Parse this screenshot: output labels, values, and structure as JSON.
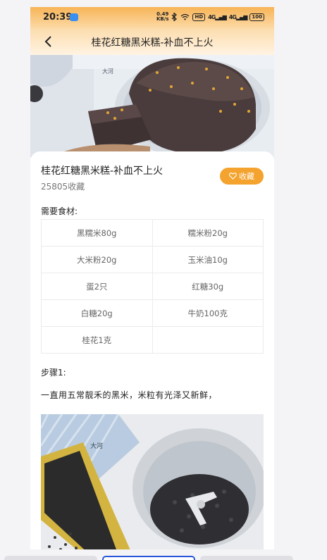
{
  "status_bar": {
    "time": "20:39",
    "speed_value": "0.49",
    "speed_unit": "KB/s",
    "hd_label": "HD",
    "net_label_1": "4G",
    "net_label_2": "4G",
    "battery": "100"
  },
  "nav": {
    "title": "桂花红糖黑米糕-补血不上火"
  },
  "recipe": {
    "title": "桂花红糖黑米糕-补血不上火",
    "favorites": "25805收藏",
    "favorite_button": "收藏",
    "ingredients_label": "需要食材:",
    "ingredients": [
      [
        "黑糯米80g",
        "糯米粉20g"
      ],
      [
        "大米粉20g",
        "玉米油10g"
      ],
      [
        "蛋2只",
        "红糖30g"
      ],
      [
        "白糖20g",
        "牛奶100克"
      ],
      [
        "桂花1克",
        ""
      ]
    ],
    "step_label": "步骤1:",
    "step_text": "一直用五常靓禾的黑米，米粒有光泽又新鲜，"
  },
  "images": {
    "watermark": "大河"
  },
  "colors": {
    "accent": "#f3a32e",
    "status_gradient_top": "#f7b456"
  },
  "icons": [
    "back-arrow-icon",
    "heart-icon",
    "bluetooth-icon",
    "wifi-icon",
    "battery-icon"
  ]
}
